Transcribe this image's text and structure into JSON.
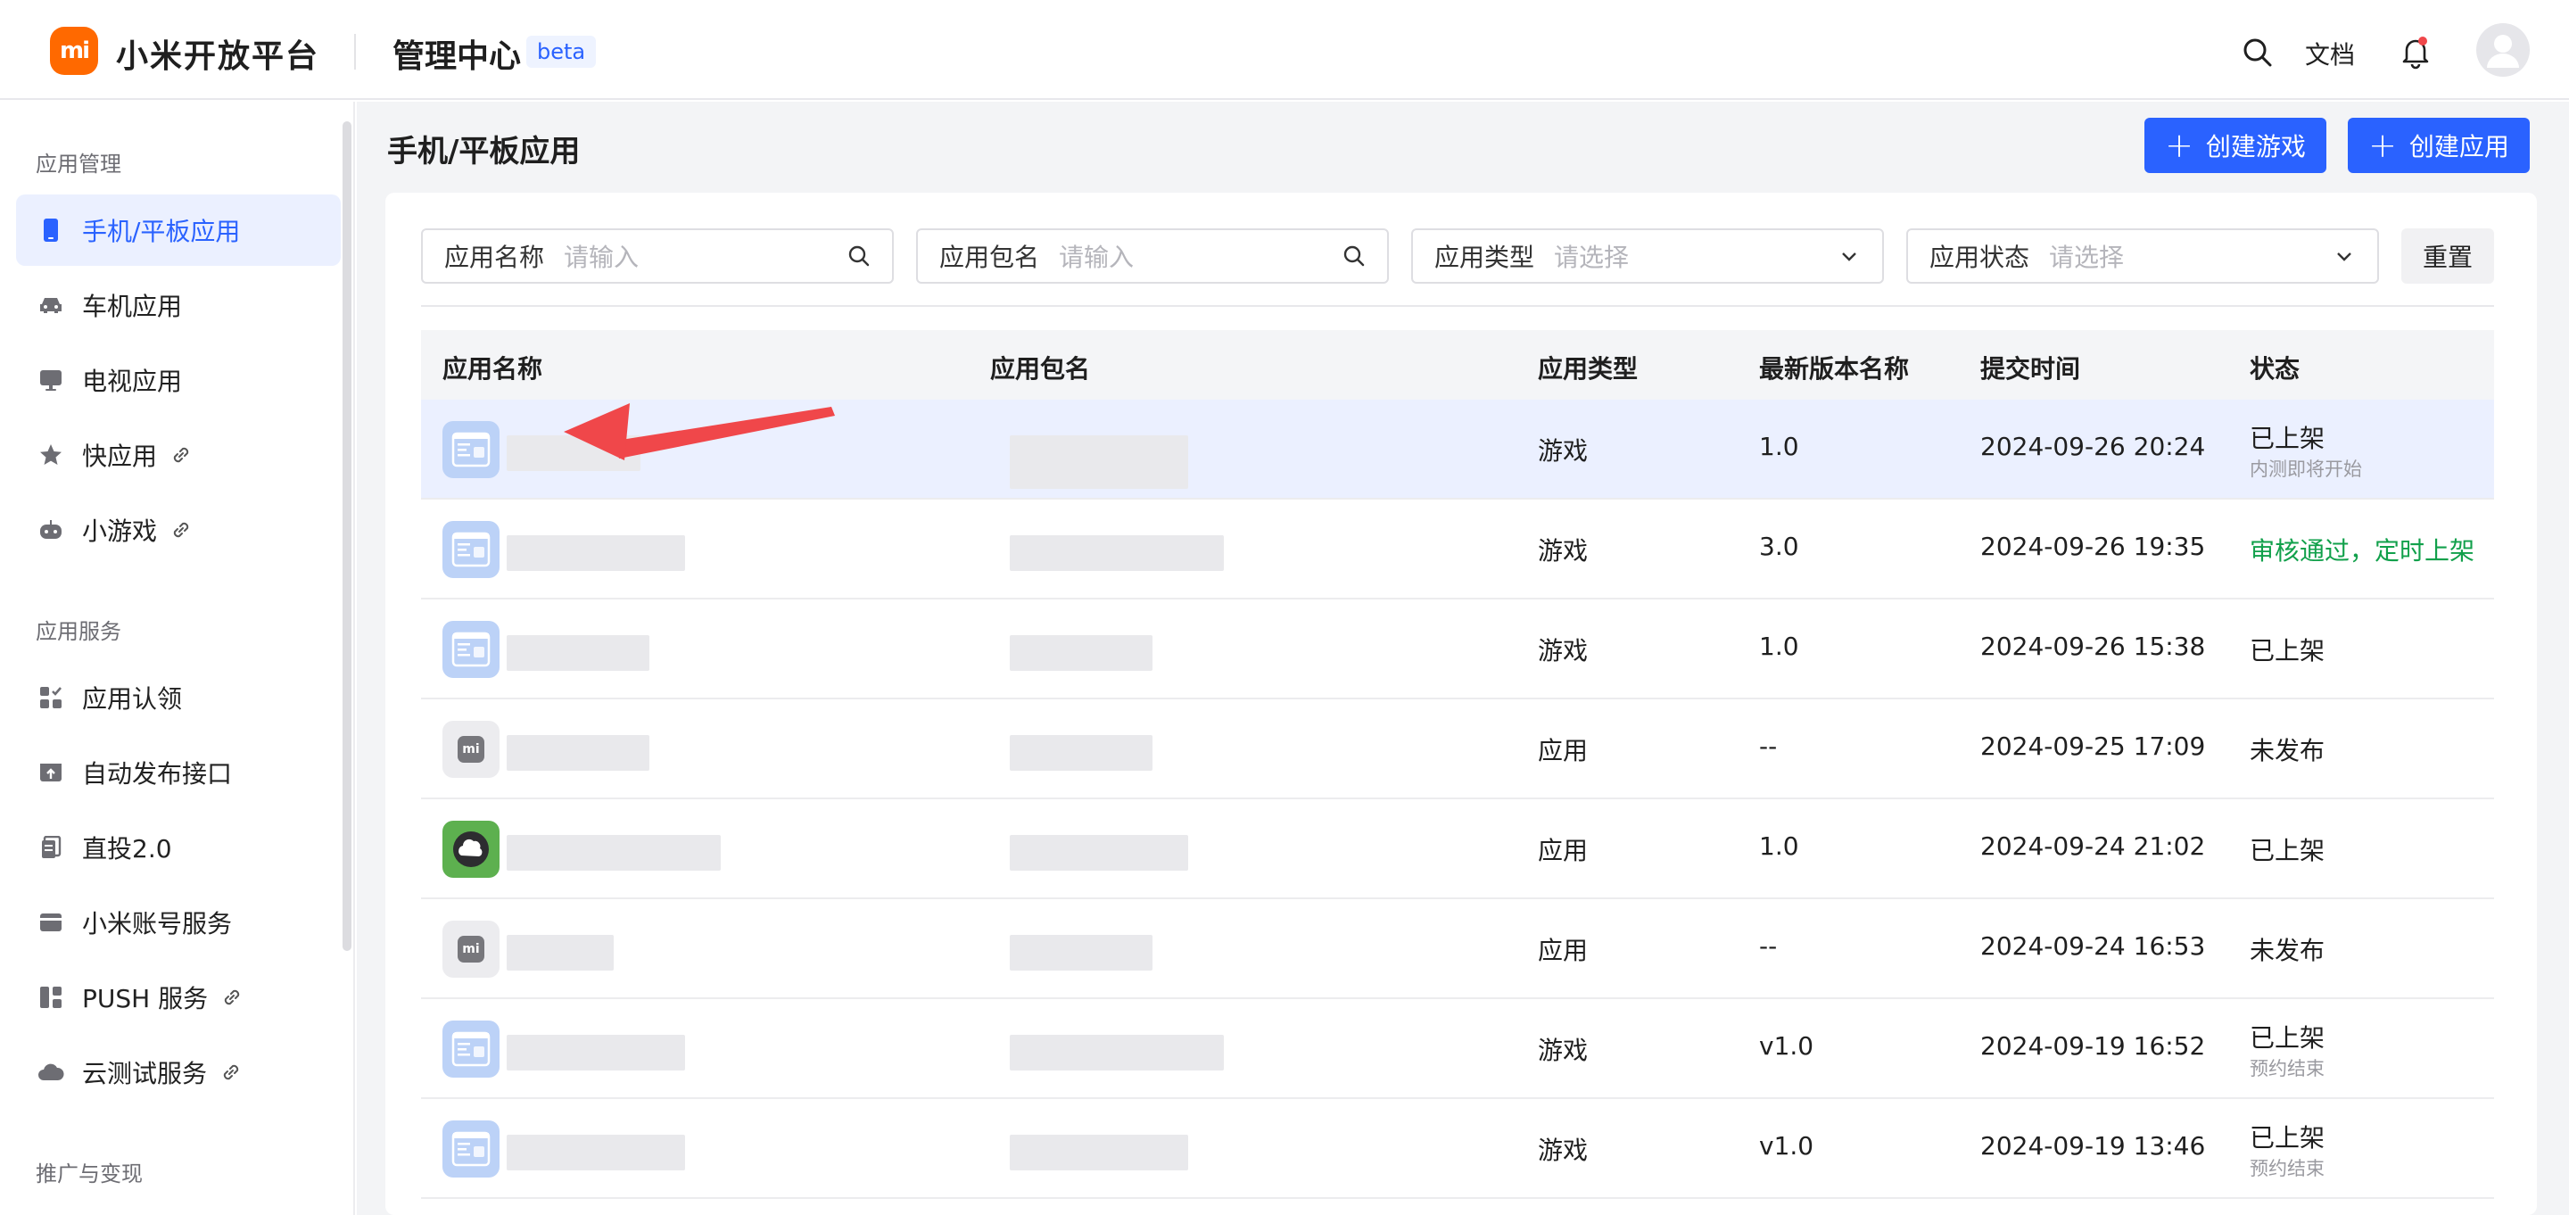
{
  "header": {
    "logo_text": "mi",
    "brand": "小米开放平台",
    "section": "管理中心",
    "badge": "beta",
    "docs": "文档"
  },
  "sidebar": {
    "groups": [
      {
        "title": "应用管理"
      },
      {
        "title": "应用服务"
      },
      {
        "title": "推广与变现"
      }
    ],
    "items": [
      {
        "label": "手机/平板应用",
        "icon": "phone-icon",
        "active": true
      },
      {
        "label": "车机应用",
        "icon": "car-icon"
      },
      {
        "label": "电视应用",
        "icon": "tv-icon"
      },
      {
        "label": "快应用",
        "icon": "star-icon",
        "external": true
      },
      {
        "label": "小游戏",
        "icon": "gamepad-icon",
        "external": true
      },
      {
        "label": "应用认领",
        "icon": "apps-check-icon"
      },
      {
        "label": "自动发布接口",
        "icon": "upload-icon"
      },
      {
        "label": "直投2.0",
        "icon": "document-icon"
      },
      {
        "label": "小米账号服务",
        "icon": "account-card-icon"
      },
      {
        "label": "PUSH 服务",
        "icon": "layout-icon",
        "external": true
      },
      {
        "label": "云测试服务",
        "icon": "cloud-icon",
        "external": true
      }
    ]
  },
  "page": {
    "title": "手机/平板应用",
    "create_game": "创建游戏",
    "create_app": "创建应用"
  },
  "filters": {
    "name_label": "应用名称",
    "name_placeholder": "请输入",
    "package_label": "应用包名",
    "package_placeholder": "请输入",
    "type_label": "应用类型",
    "type_placeholder": "请选择",
    "status_label": "应用状态",
    "status_placeholder": "请选择",
    "reset": "重置"
  },
  "table": {
    "columns": [
      "应用名称",
      "应用包名",
      "应用类型",
      "最新版本名称",
      "提交时间",
      "状态"
    ],
    "rows": [
      {
        "type": "游戏",
        "version": "1.0",
        "time": "2024-09-26 20:24",
        "status": "已上架",
        "sub": "内测即将开始",
        "icon": "game"
      },
      {
        "type": "游戏",
        "version": "3.0",
        "time": "2024-09-26 19:35",
        "status": "审核通过，定时上架",
        "sub": "",
        "icon": "game"
      },
      {
        "type": "游戏",
        "version": "1.0",
        "time": "2024-09-26 15:38",
        "status": "已上架",
        "sub": "",
        "icon": "game"
      },
      {
        "type": "应用",
        "version": "--",
        "time": "2024-09-25 17:09",
        "status": "未发布",
        "sub": "",
        "icon": "mi"
      },
      {
        "type": "应用",
        "version": "1.0",
        "time": "2024-09-24 21:02",
        "status": "已上架",
        "sub": "",
        "icon": "green"
      },
      {
        "type": "应用",
        "version": "--",
        "time": "2024-09-24 16:53",
        "status": "未发布",
        "sub": "",
        "icon": "mi"
      },
      {
        "type": "游戏",
        "version": "v1.0",
        "time": "2024-09-19 16:52",
        "status": "已上架",
        "sub": "预约结束",
        "icon": "game"
      },
      {
        "type": "游戏",
        "version": "v1.0",
        "time": "2024-09-19 13:46",
        "status": "已上架",
        "sub": "预约结束",
        "icon": "game"
      }
    ]
  },
  "colors": {
    "accent": "#2a62ff",
    "brand": "#ff6900",
    "success": "#11a04b",
    "annotation_arrow": "#f0474a"
  }
}
